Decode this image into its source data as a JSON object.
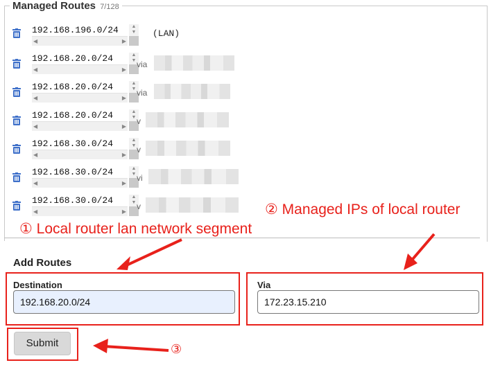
{
  "managed_routes": {
    "title": "Managed Routes",
    "count": "7/128",
    "routes": [
      {
        "destination": "192.168.196.0/24",
        "via_prefix": "",
        "lan_label": "(LAN)"
      },
      {
        "destination": "192.168.20.0/24",
        "via_prefix": "via",
        "lan_label": ""
      },
      {
        "destination": "192.168.20.0/24",
        "via_prefix": "via",
        "lan_label": ""
      },
      {
        "destination": "192.168.20.0/24",
        "via_prefix": "v",
        "lan_label": ""
      },
      {
        "destination": "192.168.30.0/24",
        "via_prefix": "v",
        "lan_label": ""
      },
      {
        "destination": "192.168.30.0/24",
        "via_prefix": "vi",
        "lan_label": ""
      },
      {
        "destination": "192.168.30.0/24",
        "via_prefix": "v",
        "lan_label": ""
      }
    ]
  },
  "add_routes": {
    "title": "Add Routes",
    "destination_label": "Destination",
    "destination_value": "192.168.20.0/24",
    "via_label": "Via",
    "via_value": "172.23.15.210",
    "submit_label": "Submit"
  },
  "annotations": {
    "note1": "① Local router lan network segment",
    "note2": "② Managed IPs of local router",
    "note3": "③"
  },
  "colors": {
    "annotation_red": "#e8211b",
    "trash_blue": "#3d6fc9",
    "destination_bg": "#e8f0fe"
  },
  "icons": {
    "delete": "trash-icon"
  }
}
